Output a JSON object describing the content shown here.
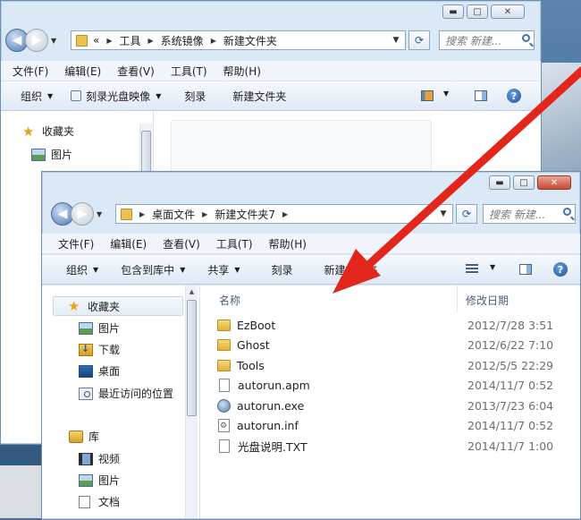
{
  "back_window": {
    "breadcrumb": [
      "工具",
      "系统镜像",
      "新建文件夹"
    ],
    "crumb_prefix": "«",
    "search_placeholder": "搜索 新建...",
    "menu": [
      "文件(F)",
      "编辑(E)",
      "查看(V)",
      "工具(T)",
      "帮助(H)"
    ],
    "toolbar": [
      "组织",
      "刻录光盘映像",
      "刻录",
      "新建文件夹"
    ],
    "nav": [
      "收藏夹",
      "图片"
    ]
  },
  "front_window": {
    "breadcrumb": [
      "桌面文件",
      "新建文件夹7"
    ],
    "search_placeholder": "搜索 新建...",
    "menu": [
      "文件(F)",
      "编辑(E)",
      "查看(V)",
      "工具(T)",
      "帮助(H)"
    ],
    "toolbar": [
      "组织",
      "包含到库中",
      "共享",
      "刻录",
      "新建文件夹"
    ],
    "nav": {
      "favorites": "收藏夹",
      "favorites_items": [
        "图片",
        "下载",
        "桌面",
        "最近访问的位置"
      ],
      "libraries": "库",
      "library_items": [
        "视频",
        "图片",
        "文档"
      ]
    },
    "columns": {
      "name": "名称",
      "modified": "修改日期"
    },
    "files": [
      {
        "name": "EzBoot",
        "date": "2012/7/28 3:51",
        "kind": "folder"
      },
      {
        "name": "Ghost",
        "date": "2012/6/22 7:10",
        "kind": "folder"
      },
      {
        "name": "Tools",
        "date": "2012/5/5 22:29",
        "kind": "folder"
      },
      {
        "name": "autorun.apm",
        "date": "2014/11/7 0:52",
        "kind": "file"
      },
      {
        "name": "autorun.exe",
        "date": "2013/7/23 6:04",
        "kind": "exe"
      },
      {
        "name": "autorun.inf",
        "date": "2014/11/7 0:52",
        "kind": "inf"
      },
      {
        "name": "光盘说明.TXT",
        "date": "2014/11/7 1:00",
        "kind": "file"
      }
    ]
  },
  "colors": {
    "annotation_arrow": "#e3261b",
    "window_frame": "#dbe8f5"
  }
}
